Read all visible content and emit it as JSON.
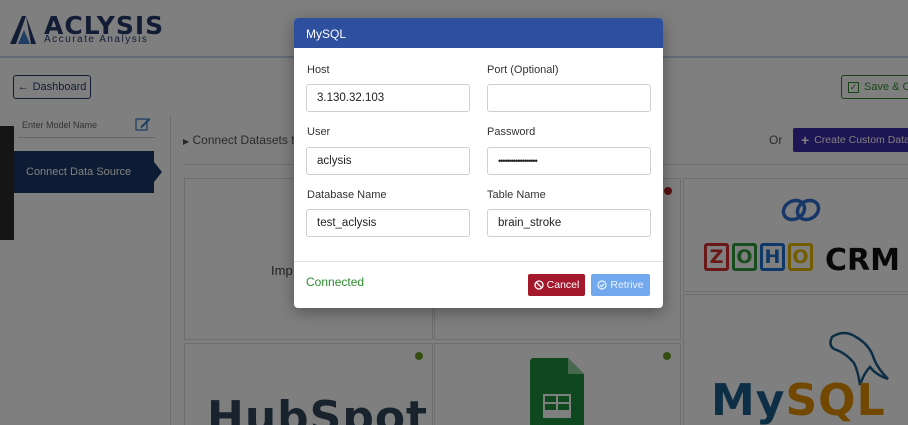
{
  "app": {
    "logo_name": "ACLYSIS",
    "logo_tagline": "Accurate Analysis"
  },
  "toolbar": {
    "dashboard_label": "Dashboard",
    "save_label": "Save & Co"
  },
  "sidebar": {
    "model_name_placeholder": "Enter Model Name",
    "active_item": "Connect Data Source"
  },
  "main": {
    "connect_text": "Connect Datasets to",
    "or_text": "Or",
    "create_custom_label": "Create Custom Data",
    "import_text": "Imp",
    "cards": {
      "zoho": {
        "letters": [
          "Z",
          "O",
          "H",
          "O"
        ],
        "suffix": "CRM"
      },
      "hubspot": {
        "text": "HubSpot"
      },
      "mysql": {
        "text": "MySQL"
      }
    },
    "colors": {
      "status_green": "#6a9a1f",
      "status_red": "#b22222"
    }
  },
  "modal": {
    "title": "MySQL",
    "fields": {
      "host": {
        "label": "Host",
        "value": "3.130.32.103"
      },
      "port": {
        "label": "Port (Optional)",
        "value": ""
      },
      "user": {
        "label": "User",
        "value": "aclysis"
      },
      "password": {
        "label": "Password",
        "value": "••••••••••••••••••"
      },
      "database": {
        "label": "Database Name",
        "value": "test_aclysis"
      },
      "table": {
        "label": "Table Name",
        "value": "brain_stroke"
      }
    },
    "status": "Connected",
    "cancel_label": "Cancel",
    "retrive_label": "Retrive"
  }
}
